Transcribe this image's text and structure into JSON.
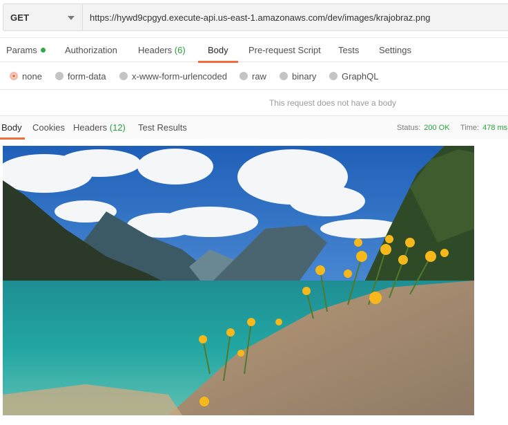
{
  "request": {
    "method": "GET",
    "url": "https://hywd9cpgyd.execute-api.us-east-1.amazonaws.com/dev/images/krajobraz.png"
  },
  "request_tabs": [
    {
      "label": "Params",
      "indicator": "green-dot"
    },
    {
      "label": "Authorization"
    },
    {
      "label": "Headers",
      "count": "(6)"
    },
    {
      "label": "Body",
      "active": true
    },
    {
      "label": "Pre-request Script"
    },
    {
      "label": "Tests"
    },
    {
      "label": "Settings"
    }
  ],
  "body_types": [
    {
      "label": "none",
      "selected": true
    },
    {
      "label": "form-data"
    },
    {
      "label": "x-www-form-urlencoded"
    },
    {
      "label": "raw"
    },
    {
      "label": "binary"
    },
    {
      "label": "GraphQL"
    }
  ],
  "no_body_message": "This request does not have a body",
  "response_tabs": [
    {
      "label": "Body",
      "active": true
    },
    {
      "label": "Cookies"
    },
    {
      "label": "Headers",
      "count": "(12)"
    },
    {
      "label": "Test Results"
    }
  ],
  "response_status": {
    "status_label": "Status:",
    "status_value": "200 OK",
    "time_label": "Time:",
    "time_value": "478 ms"
  },
  "colors": {
    "accent": "#f26b3a",
    "success": "#26a13a"
  }
}
